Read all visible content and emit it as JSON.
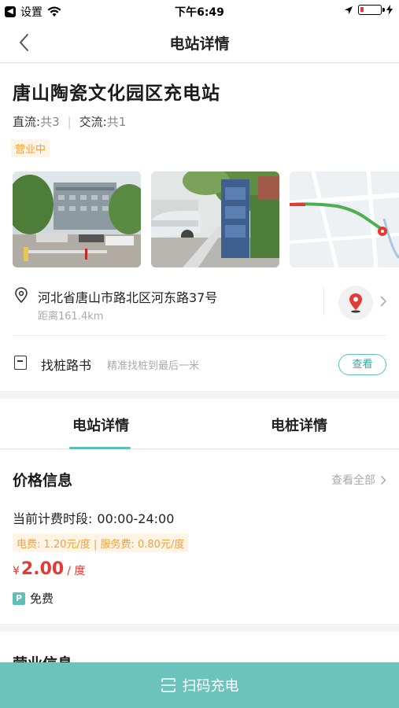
{
  "status_bar": {
    "back_app": "设置",
    "time": "下午6:49"
  },
  "navbar": {
    "title": "电站详情"
  },
  "station": {
    "name": "唐山陶瓷文化园区充电站",
    "dc_label": "直流:",
    "dc_count": "共3",
    "ac_label": "交流:",
    "ac_count": "共1",
    "status": "营业中",
    "photos": [
      "building-photo",
      "charger-photo",
      "map-thumbnail"
    ]
  },
  "address": {
    "text": "河北省唐山市路北区河东路37号",
    "distance": "距离161.4km"
  },
  "guide": {
    "label": "找桩路书",
    "subtitle": "精准找桩到最后一米",
    "button": "查看"
  },
  "tabs": [
    {
      "label": "电站详情",
      "active": true
    },
    {
      "label": "电桩详情",
      "active": false
    }
  ],
  "price_info": {
    "title": "价格信息",
    "see_all": "查看全部",
    "period_label": "当前计费时段:",
    "period_value": "00:00-24:00",
    "fee_detail": "电费: 1.20元/度 | 服务费: 0.80元/度",
    "currency": "¥",
    "amount": "2.00",
    "unit": "/ 度",
    "parking_icon": "P",
    "parking": "免费"
  },
  "business_info": {
    "title": "营业信息"
  },
  "scan_button": {
    "label": "扫码充电"
  },
  "colors": {
    "accent": "#5fbfb6",
    "scan_bar": "#6cc3bb",
    "price_red": "#e53935",
    "badge_orange": "#f0a23b"
  }
}
